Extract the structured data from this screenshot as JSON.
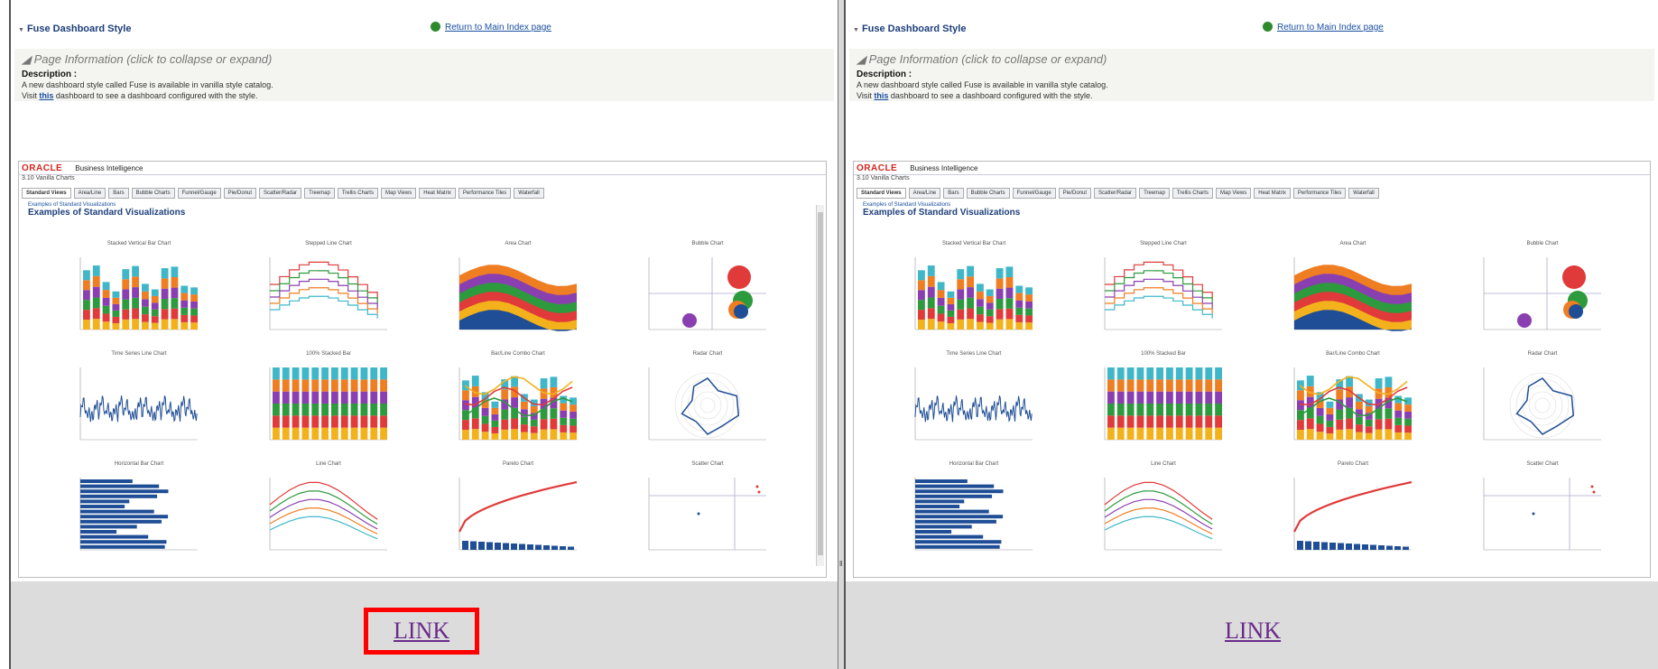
{
  "header": {
    "title": "Fuse Dashboard Style",
    "return_link": "Return to Main Index page"
  },
  "page_info": {
    "heading": "Page Information (click to collapse or expand)",
    "description_label": "Description :",
    "line1": "A new dashboard style called Fuse is available in vanilla style catalog.",
    "line2_prefix": "Visit ",
    "line2_link": "this",
    "line2_suffix": " dashboard to see a dashboard configured with the style."
  },
  "embedded": {
    "brand": "ORACLE",
    "app_name": "Business Intelligence",
    "subtitle": "3.10 Vanilla Charts",
    "tabs": [
      "Standard Views",
      "Area/Line",
      "Bars",
      "Bubble Charts",
      "Funnel/Gauge",
      "Pie/Donut",
      "Scatter/Radar",
      "Treemap",
      "Trellis Charts",
      "Map Views",
      "Heat Matrix",
      "Performance Tiles",
      "Waterfall"
    ],
    "breadcrumb": "Examples of Standard Visualizations",
    "title": "Examples of Standard Visualizations",
    "chart_titles": [
      "Stacked Vertical Bar Chart",
      "Stepped Line Chart",
      "Area Chart",
      "Bubble Chart",
      "Time Series Line Chart",
      "100% Stacked Bar",
      "Bar/Line Combo Chart",
      "Radar Chart",
      "Horizontal Bar Chart",
      "Line Chart",
      "Pareto Chart",
      "Scatter Chart"
    ]
  },
  "links": {
    "left": "LINK",
    "right": "LINK"
  },
  "colors": {
    "highlight": "#ff0000",
    "link": "#6a2a8a",
    "oracle_red": "#d2261f",
    "title_blue": "#1d3f7a"
  }
}
